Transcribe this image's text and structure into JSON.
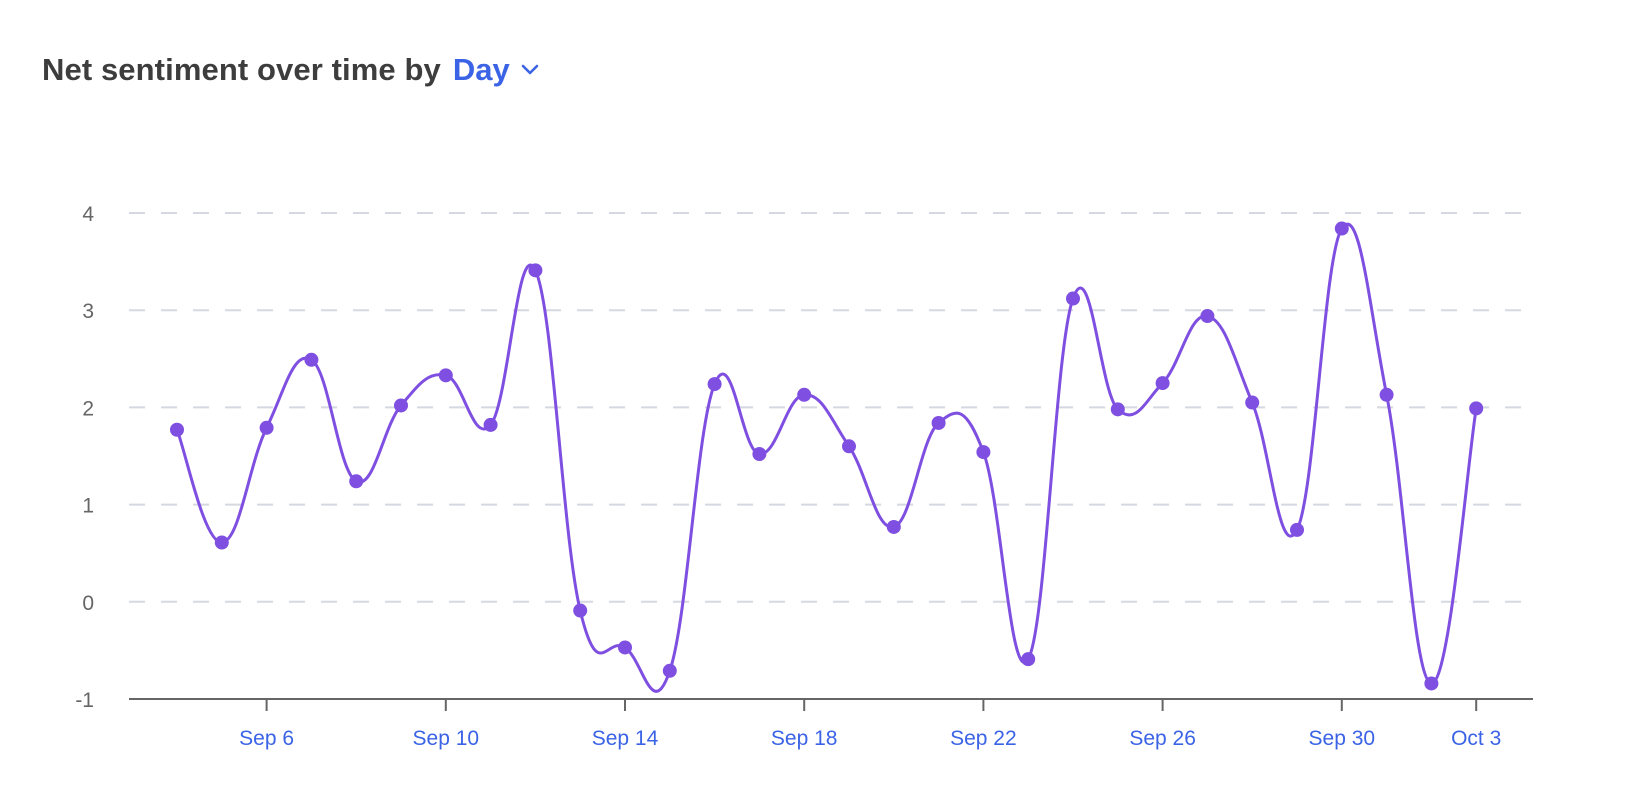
{
  "header": {
    "title": "Net sentiment over time by",
    "period_selector": {
      "value": "Day",
      "icon": "chevron-down-icon"
    }
  },
  "colors": {
    "line": "#7e4fe0",
    "accent": "#3b63e6",
    "grid": "#d5d8e1",
    "axis": "#666666"
  },
  "chart_data": {
    "type": "line",
    "title": "Net sentiment over time by Day",
    "xlabel": "",
    "ylabel": "",
    "ylim": [
      -1,
      4
    ],
    "yticks": [
      -1,
      0,
      1,
      2,
      3,
      4
    ],
    "grid": true,
    "smooth": true,
    "x_tick_labels": [
      "Sep 6",
      "Sep 10",
      "Sep 14",
      "Sep 18",
      "Sep 22",
      "Sep 26",
      "Sep 30",
      "Oct 3"
    ],
    "x_tick_index": [
      2,
      6,
      10,
      14,
      18,
      22,
      26,
      29
    ],
    "x": [
      "Sep 4",
      "Sep 5",
      "Sep 6",
      "Sep 7",
      "Sep 8",
      "Sep 9",
      "Sep 10",
      "Sep 11",
      "Sep 12",
      "Sep 13",
      "Sep 14",
      "Sep 15",
      "Sep 16",
      "Sep 17",
      "Sep 18",
      "Sep 19",
      "Sep 20",
      "Sep 21",
      "Sep 22",
      "Sep 23",
      "Sep 24",
      "Sep 25",
      "Sep 26",
      "Sep 27",
      "Sep 28",
      "Sep 29",
      "Sep 30",
      "Oct 1",
      "Oct 2",
      "Oct 3"
    ],
    "series": [
      {
        "name": "Net sentiment",
        "values": [
          1.77,
          0.61,
          1.79,
          2.49,
          1.24,
          2.02,
          2.33,
          1.82,
          3.41,
          -0.09,
          -0.47,
          -0.71,
          2.24,
          1.52,
          2.13,
          1.6,
          0.77,
          1.84,
          1.54,
          -0.59,
          3.12,
          1.98,
          2.25,
          2.94,
          2.05,
          0.74,
          3.84,
          2.13,
          -0.84,
          1.99
        ]
      }
    ]
  }
}
